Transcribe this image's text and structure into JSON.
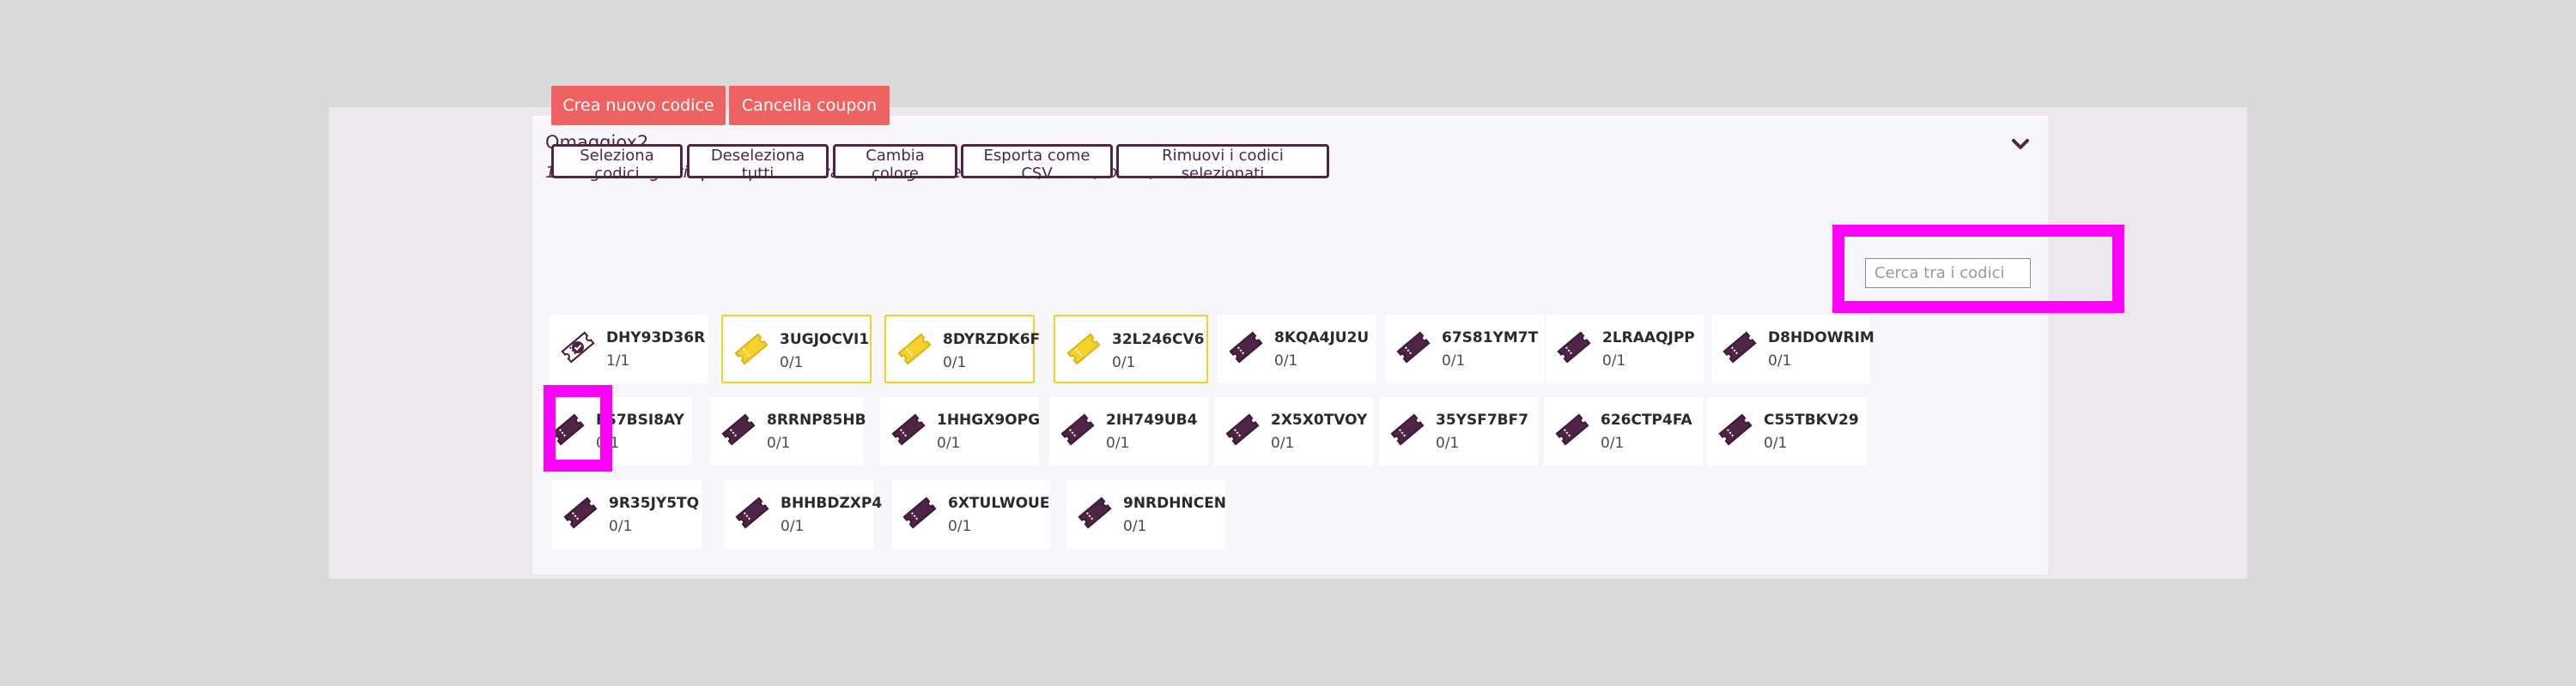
{
  "coupon": {
    "title": "Omaggiox2",
    "description": "1 x ingresso gratis per 2 persone valido per gli eventi Tour 1,Tour 2,Tour 3,Tour 4"
  },
  "actions": {
    "create_code": "Crea nuovo codice",
    "delete_coupon": "Cancella coupon"
  },
  "toolbar": {
    "select_codes": "Seleziona codici",
    "deselect_all": "Deseleziona tutti",
    "change_color": "Cambia colore",
    "export_csv": "Esporta come CSV",
    "remove_selected": "Rimuovi i codici selezionati"
  },
  "search": {
    "placeholder": "Cerca tra i codici"
  },
  "colors": {
    "accent": "#ef6262",
    "primary": "#4f2545",
    "highlight": "#ff00ff",
    "yellow": "#f4d22a"
  },
  "codes": [
    {
      "code": "DHY93D36R",
      "usage": "1/1",
      "icon": "redeemed-ticket-icon",
      "color": "purple"
    },
    {
      "code": "3UGJOCVI1",
      "usage": "0/1",
      "icon": "ticket-icon",
      "color": "yellow"
    },
    {
      "code": "8DYRZDK6F",
      "usage": "0/1",
      "icon": "ticket-icon",
      "color": "yellow"
    },
    {
      "code": "32L246CV6",
      "usage": "0/1",
      "icon": "ticket-icon",
      "color": "yellow"
    },
    {
      "code": "8KQA4JU2U",
      "usage": "0/1",
      "icon": "ticket-icon",
      "color": "purple"
    },
    {
      "code": "67S81YM7T",
      "usage": "0/1",
      "icon": "ticket-icon",
      "color": "purple"
    },
    {
      "code": "2LRAAQJPP",
      "usage": "0/1",
      "icon": "ticket-icon",
      "color": "purple"
    },
    {
      "code": "D8HDOWRIM",
      "usage": "0/1",
      "icon": "ticket-icon",
      "color": "purple"
    },
    {
      "code": "FS7BSI8AY",
      "usage": "0/1",
      "icon": "ticket-icon",
      "color": "purple"
    },
    {
      "code": "8RRNP85HB",
      "usage": "0/1",
      "icon": "ticket-icon",
      "color": "purple"
    },
    {
      "code": "1HHGX9OPG",
      "usage": "0/1",
      "icon": "ticket-icon",
      "color": "purple"
    },
    {
      "code": "2IH749UB4",
      "usage": "0/1",
      "icon": "ticket-icon",
      "color": "purple"
    },
    {
      "code": "2X5X0TVOY",
      "usage": "0/1",
      "icon": "ticket-icon",
      "color": "purple"
    },
    {
      "code": "35YSF7BF7",
      "usage": "0/1",
      "icon": "ticket-icon",
      "color": "purple"
    },
    {
      "code": "626CTP4FA",
      "usage": "0/1",
      "icon": "ticket-icon",
      "color": "purple"
    },
    {
      "code": "C55TBKV29",
      "usage": "0/1",
      "icon": "ticket-icon",
      "color": "purple"
    },
    {
      "code": "9R35JY5TQ",
      "usage": "0/1",
      "icon": "ticket-icon",
      "color": "purple"
    },
    {
      "code": "BHHBDZXP4",
      "usage": "0/1",
      "icon": "ticket-icon",
      "color": "purple"
    },
    {
      "code": "6XTULWOUE",
      "usage": "0/1",
      "icon": "ticket-icon",
      "color": "purple"
    },
    {
      "code": "9NRDHNCEN",
      "usage": "0/1",
      "icon": "ticket-icon",
      "color": "purple"
    }
  ]
}
